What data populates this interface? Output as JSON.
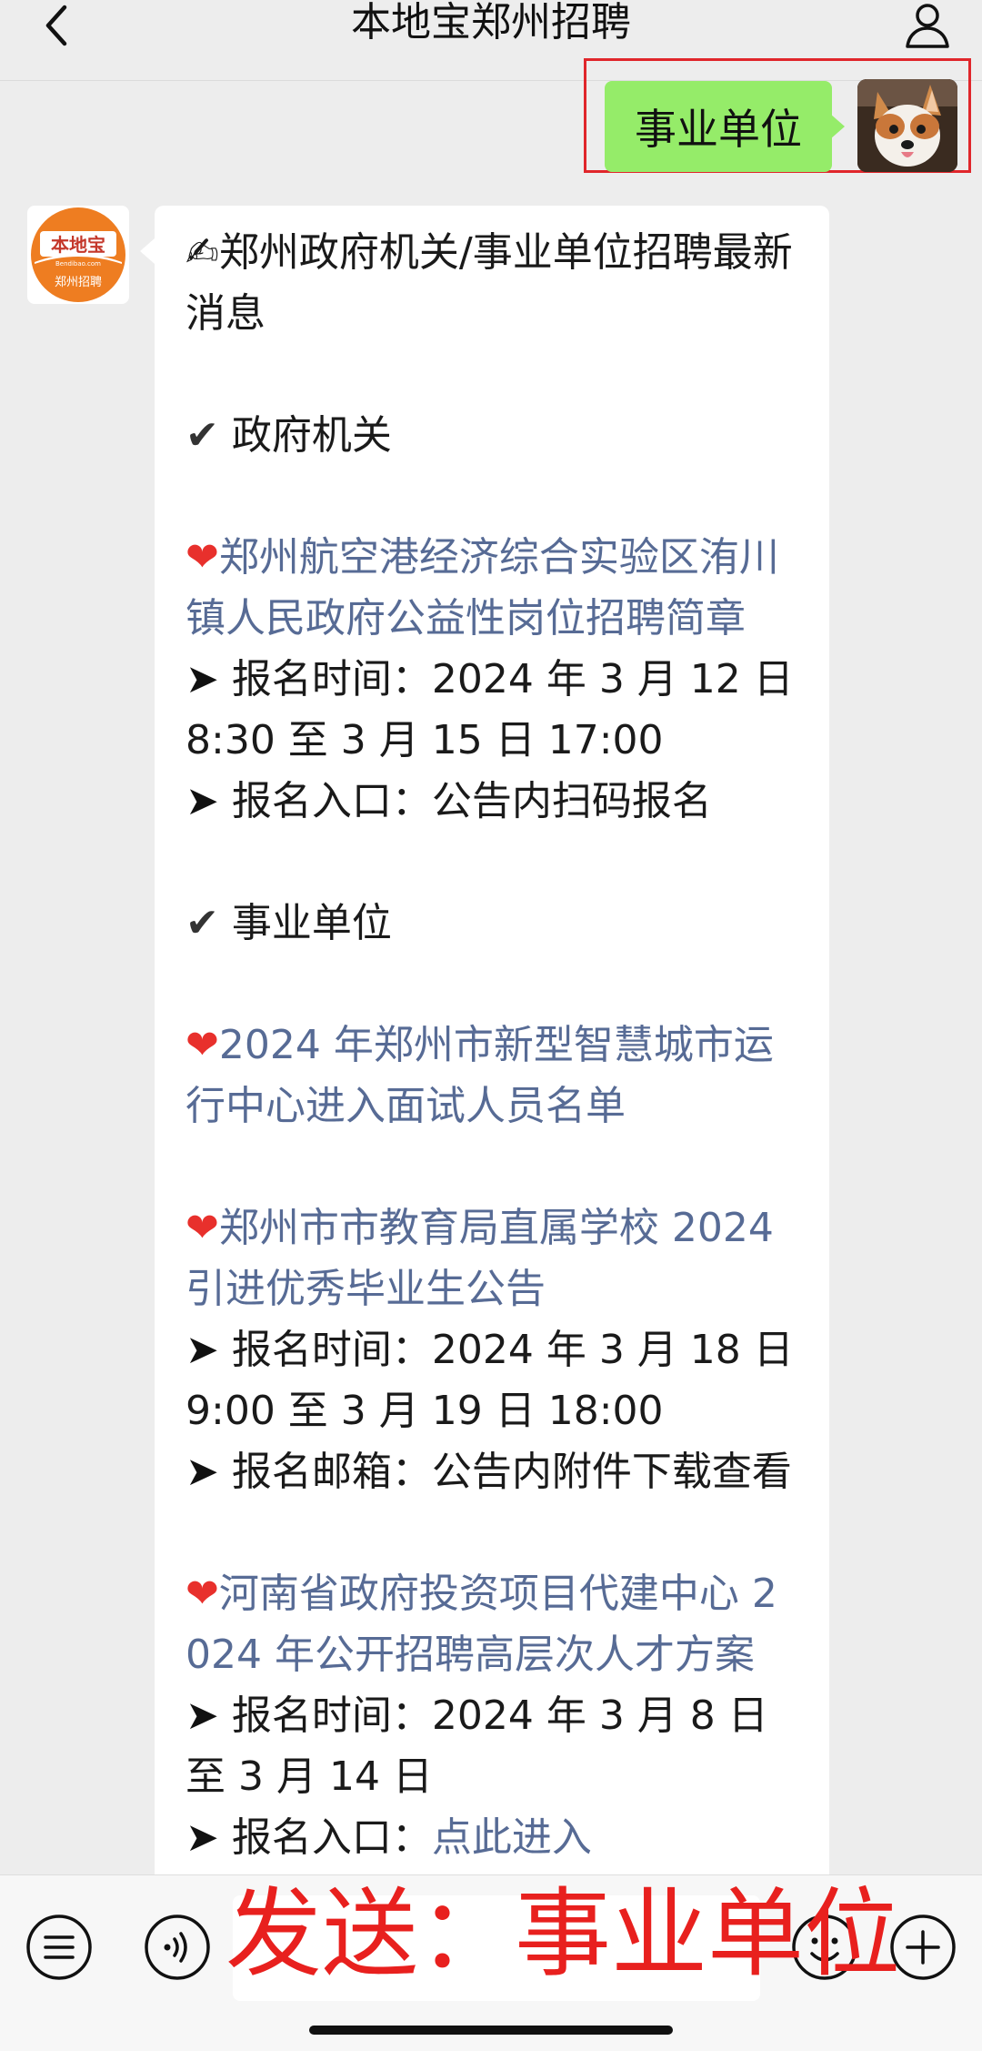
{
  "header": {
    "title": "本地宝郑州招聘"
  },
  "outgoing_message": {
    "text": "事业单位"
  },
  "bot_avatar": {
    "brand_top": "本地宝",
    "brand_url": "Bendibao.com",
    "brand_bottom": "郑州招聘"
  },
  "incoming_message": {
    "intro_emoji": "✍",
    "intro_text": "郑州政府机关/事业单位招聘最新消息",
    "check_mark": "✔",
    "heart": "❤",
    "arrow": "➤",
    "section_gov": "政府机关",
    "gov_items": [
      {
        "title": "郑州航空港经济综合实验区洧川镇人民政府公益性岗位招聘简章",
        "time_label": "报名时间：",
        "time_value": "2024 年 3 月 12 日 8:30 至 3 月 15 日 17:00",
        "entry_label": "报名入口：",
        "entry_value": "公告内扫码报名"
      }
    ],
    "section_inst": "事业单位",
    "inst_items": [
      {
        "title": "2024 年郑州市新型智慧城市运行中心进入面试人员名单"
      },
      {
        "title": "郑州市市教育局直属学校 2024 引进优秀毕业生公告",
        "time_label": "报名时间：",
        "time_value": "2024 年 3 月 18 日 9:00 至 3 月 19 日 18:00",
        "mail_label": "报名邮箱：",
        "mail_value": "公告内附件下载查看"
      },
      {
        "title": "河南省政府投资项目代建中心 2024 年公开招聘高层次人才方案",
        "time_label": "报名时间：",
        "time_value": "2024 年 3 月 8 日至 3 月 14 日",
        "entry_label": "报名入口：",
        "entry_value": "点此进入"
      }
    ]
  },
  "bottom_bar": {
    "overlay_text": "发送：事业单位"
  },
  "colors": {
    "background": "#ededed",
    "outgoing_bubble": "#95ec69",
    "link": "#576b95",
    "highlight_border": "#e0262b",
    "overlay_text": "#e8201e",
    "brand_orange": "#ee7d21"
  },
  "icons": {
    "back": "chevron-left-icon",
    "profile": "person-icon",
    "keyboard": "keyboard-icon",
    "voice": "voice-icon",
    "emoji": "emoji-icon",
    "plus": "plus-icon"
  }
}
